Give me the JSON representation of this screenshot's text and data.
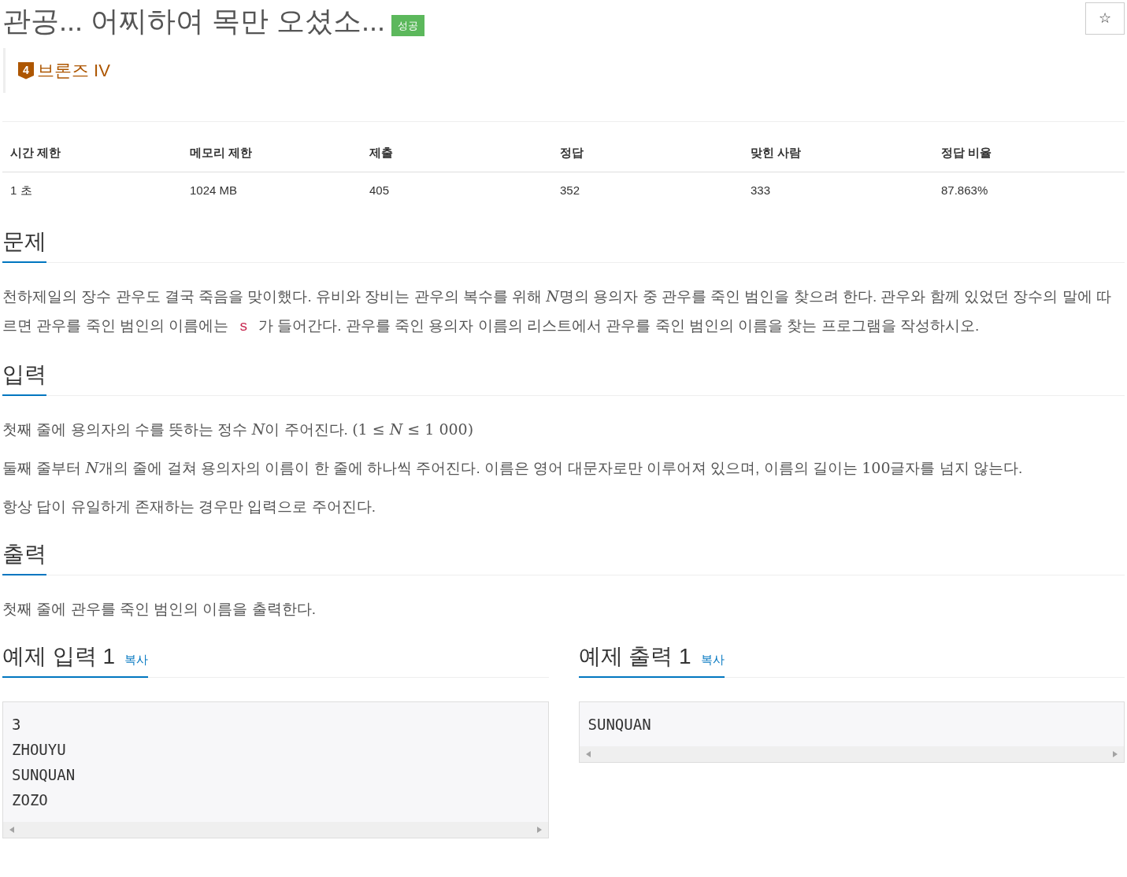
{
  "title": "관공... 어찌하여 목만 오셨소...",
  "result_badge": "성공",
  "star_button": "☆",
  "tier": {
    "level": "4",
    "label": "브론즈 IV"
  },
  "stats_table": {
    "columns": [
      "시간 제한",
      "메모리 제한",
      "제출",
      "정답",
      "맞힌 사람",
      "정답 비율"
    ],
    "rows": [
      [
        "1 초",
        "1024 MB",
        "405",
        "352",
        "333",
        "87.863%"
      ]
    ]
  },
  "sections": [
    {
      "heading": "문제",
      "paragraphs": [
        [
          {
            "kind": "text",
            "text": "천하제일의 장수 관우도 결국 죽음을 맞이했다. 유비와 장비는 관우의 복수를 위해 "
          },
          {
            "kind": "math",
            "text": "*N*"
          },
          {
            "kind": "text",
            "text": "명의 용의자 중 관우를 죽인 범인을 찾으려 한다. 관우와 함께 있었던 장수의 말에 따르면 관우를 죽인 범인의 이름에는 "
          },
          {
            "kind": "code",
            "text": "s"
          },
          {
            "kind": "text",
            "text": " 가 들어간다. 관우를 죽인 용의자 이름의 리스트에서 관우를 죽인 범인의 이름을 찾는 프로그램을 작성하시오."
          }
        ]
      ]
    },
    {
      "heading": "입력",
      "paragraphs": [
        [
          {
            "kind": "text",
            "text": "첫째 줄에 용의자의 수를 뜻하는 정수 "
          },
          {
            "kind": "math",
            "text": "*N*"
          },
          {
            "kind": "text",
            "text": "이 주어진다. "
          },
          {
            "kind": "math",
            "text": "(1 ≤ *N* ≤ 1 000)"
          }
        ],
        [
          {
            "kind": "text",
            "text": "둘째 줄부터 "
          },
          {
            "kind": "math",
            "text": "*N*"
          },
          {
            "kind": "text",
            "text": "개의 줄에 걸쳐 용의자의 이름이 한 줄에 하나씩 주어진다. 이름은 영어 대문자로만 이루어져 있으며, 이름의 길이는 "
          },
          {
            "kind": "math",
            "text": "100"
          },
          {
            "kind": "text",
            "text": "글자를 넘지 않는다."
          }
        ],
        [
          {
            "kind": "text",
            "text": "항상 답이 유일하게 존재하는 경우만 입력으로 주어진다."
          }
        ]
      ]
    },
    {
      "heading": "출력",
      "paragraphs": [
        [
          {
            "kind": "text",
            "text": "첫째 줄에 관우를 죽인 범인의 이름을 출력한다."
          }
        ]
      ]
    }
  ],
  "samples": [
    {
      "heading": "예제 입력 1",
      "copy": "복사",
      "lines": [
        "3",
        "ZHOUYU",
        "SUNQUAN",
        "ZOZO"
      ]
    },
    {
      "heading": "예제 출력 1",
      "copy": "복사",
      "lines": [
        "SUNQUAN"
      ]
    }
  ]
}
